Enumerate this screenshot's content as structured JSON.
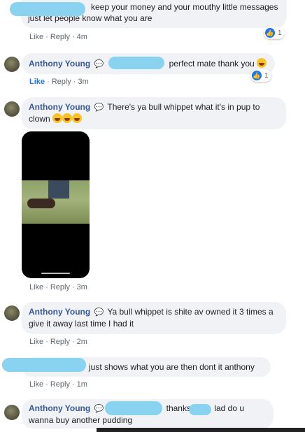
{
  "comments": [
    {
      "author": "",
      "text": "keep your money and your mouthy little messages just let people know what you are",
      "like": "Like",
      "reply": "Reply",
      "time": "4m",
      "reactions": "1"
    },
    {
      "author": "Anthony Young",
      "text": "perfect mate thank you",
      "like": "Like",
      "reply": "Reply",
      "time": "3m",
      "reactions": "1"
    },
    {
      "author": "Anthony Young",
      "text": "There's ya bull whippet what it's in pup to clown",
      "like": "Like",
      "reply": "Reply",
      "time": "3m"
    },
    {
      "author": "Anthony Young",
      "text": "Ya bull whippet is shite av owned it 3 times a give it away last time I had it",
      "like": "Like",
      "reply": "Reply",
      "time": "2m"
    },
    {
      "author": "",
      "text": "just shows what you are then dont it anthony",
      "like": "Like",
      "reply": "Reply",
      "time": "1m"
    },
    {
      "author": "Anthony Young",
      "text_part1": "thanks",
      "text_part2": "lad do u wanna buy another pudding"
    }
  ],
  "separator": "·",
  "icons": {
    "messenger": "messenger-icon",
    "like": "like-icon",
    "emoji": "laughing-emoji-icon"
  }
}
